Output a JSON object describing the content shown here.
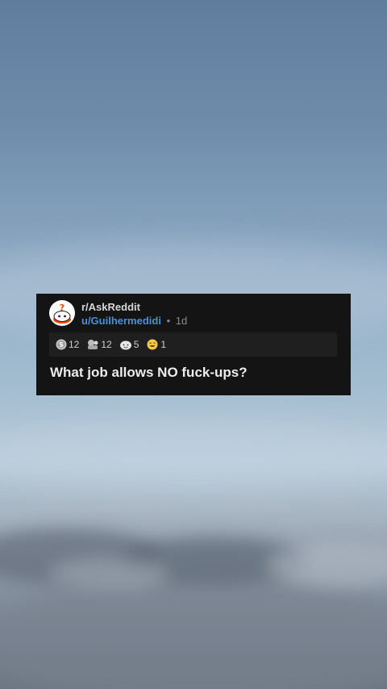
{
  "post": {
    "subreddit": "r/AskReddit",
    "username": "u/Guilhermedidi",
    "separator": "•",
    "age": "1d",
    "title": "What job allows NO fuck-ups?",
    "awards": [
      {
        "icon": "silver-award-icon",
        "count": "12"
      },
      {
        "icon": "helpful-award-icon",
        "count": "12"
      },
      {
        "icon": "wholesome-award-icon",
        "count": "5"
      },
      {
        "icon": "laughing-award-icon",
        "count": "1"
      }
    ]
  },
  "colors": {
    "card_background": "#141414",
    "username": "#4a90d9",
    "title_text": "#ececec",
    "awards_background": "#1f1f1f"
  }
}
